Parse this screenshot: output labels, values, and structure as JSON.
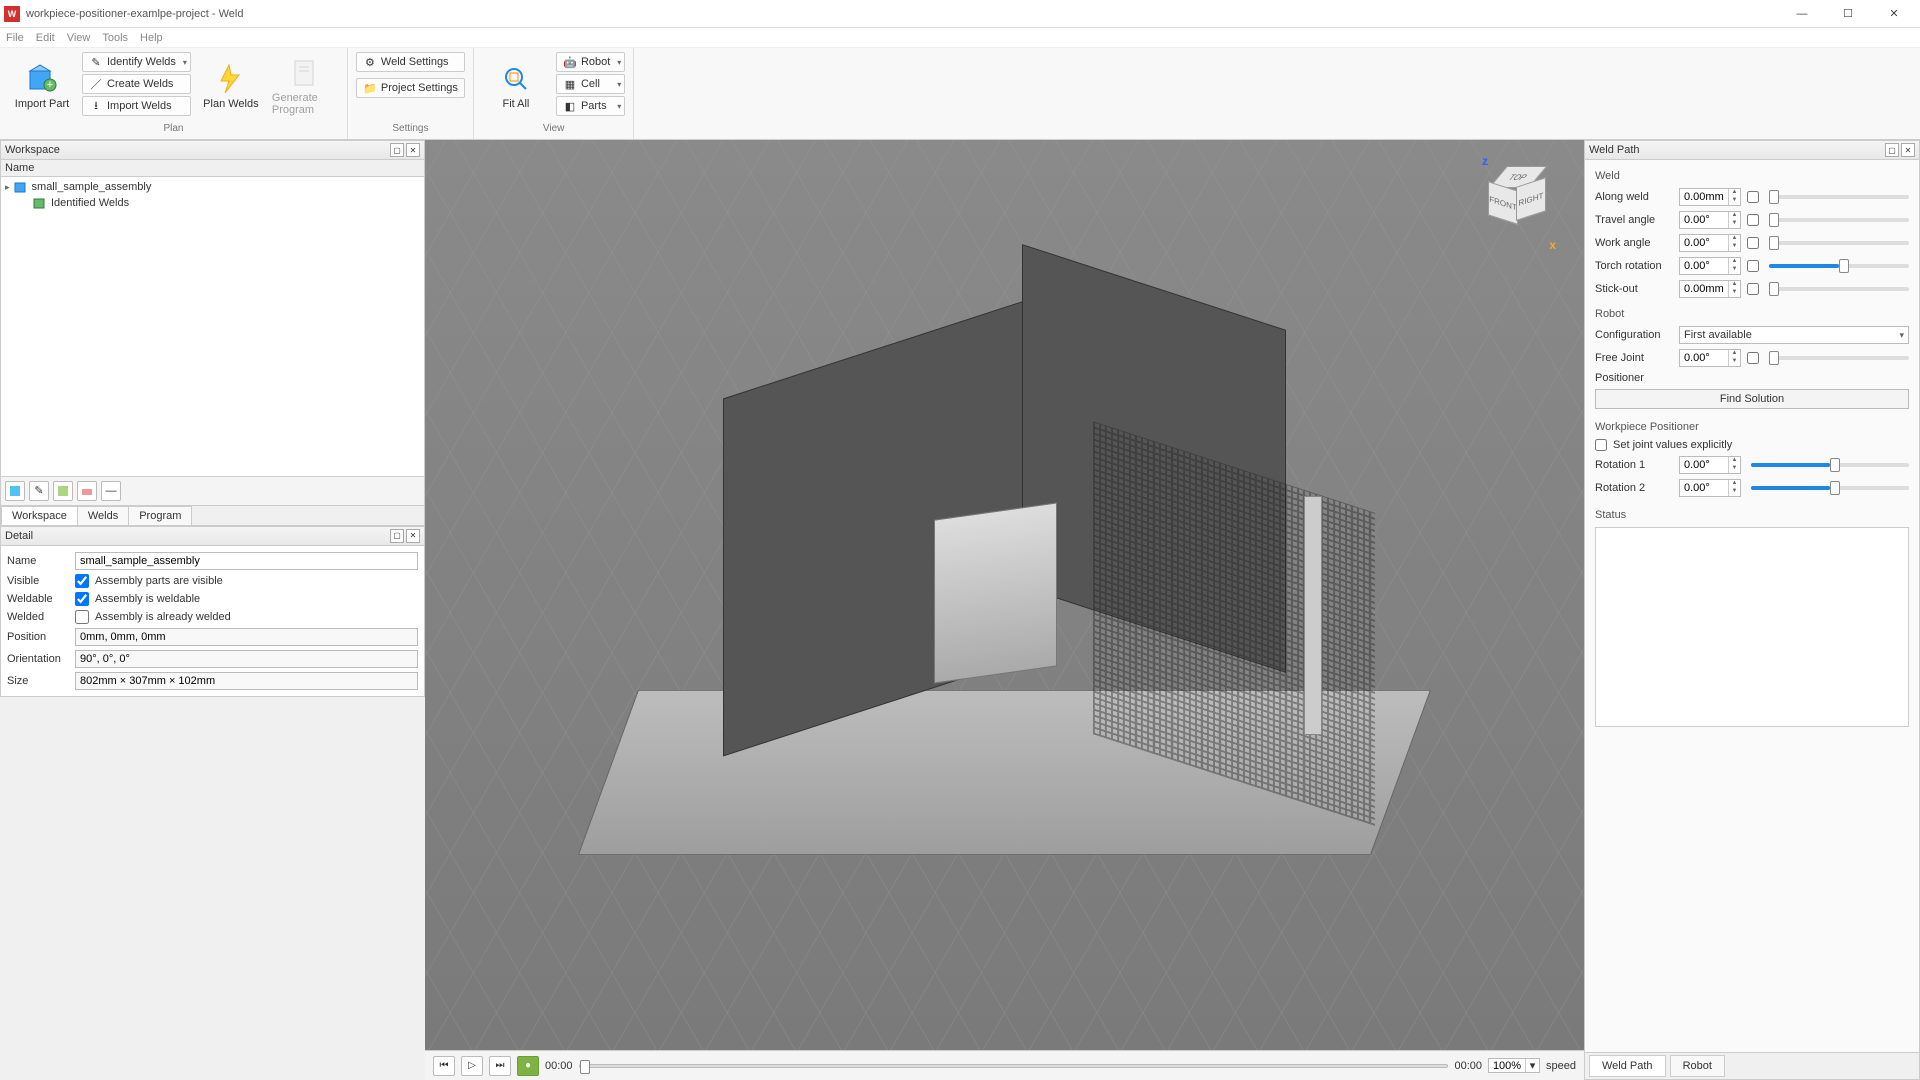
{
  "window": {
    "title": "workpiece-positioner-examlpe-project - Weld",
    "menus": [
      "File",
      "Edit",
      "View",
      "Tools",
      "Help"
    ]
  },
  "ribbon": {
    "import_part": "Import Part",
    "identify_welds": "Identify Welds",
    "create_welds": "Create Welds",
    "import_welds": "Import Welds",
    "plan_welds": "Plan Welds",
    "generate_program": "Generate Program",
    "plan_group": "Plan",
    "weld_settings": "Weld Settings",
    "project_settings": "Project Settings",
    "settings_group": "Settings",
    "fit_all": "Fit All",
    "robot": "Robot",
    "cell": "Cell",
    "parts": "Parts",
    "view_group": "View"
  },
  "workspace": {
    "title": "Workspace",
    "col_name": "Name",
    "items": [
      "small_sample_assembly",
      "Identified Welds"
    ],
    "tabs": [
      "Workspace",
      "Welds",
      "Program"
    ]
  },
  "detail": {
    "title": "Detail",
    "name_lbl": "Name",
    "name_val": "small_sample_assembly",
    "visible_lbl": "Visible",
    "visible_txt": "Assembly parts are visible",
    "weldable_lbl": "Weldable",
    "weldable_txt": "Assembly is weldable",
    "welded_lbl": "Welded",
    "welded_txt": "Assembly is already welded",
    "position_lbl": "Position",
    "position_val": "0mm, 0mm, 0mm",
    "orientation_lbl": "Orientation",
    "orientation_val": "90°, 0°, 0°",
    "size_lbl": "Size",
    "size_val": "802mm × 307mm × 102mm"
  },
  "viewcube": {
    "z": "z",
    "x": "x",
    "top": "TOP",
    "front": "FRONT",
    "right": "RIGHT"
  },
  "playbar": {
    "time_start": "00:00",
    "time_end": "00:00",
    "zoom": "100%",
    "speed": "speed"
  },
  "weldpath": {
    "title": "Weld Path",
    "weld_section": "Weld",
    "along_weld_lbl": "Along weld",
    "along_weld_val": "0.00mm",
    "travel_angle_lbl": "Travel angle",
    "travel_angle_val": "0.00°",
    "work_angle_lbl": "Work angle",
    "work_angle_val": "0.00°",
    "torch_rot_lbl": "Torch rotation",
    "torch_rot_val": "0.00°",
    "stick_out_lbl": "Stick-out",
    "stick_out_val": "0.00mm",
    "robot_section": "Robot",
    "config_lbl": "Configuration",
    "config_val": "First available",
    "free_joint_lbl": "Free Joint",
    "free_joint_val": "0.00°",
    "positioner_lbl": "Positioner",
    "find_solution": "Find Solution",
    "wp_section": "Workpiece Positioner",
    "set_explicit": "Set joint values explicitly",
    "rot1_lbl": "Rotation 1",
    "rot1_val": "0.00°",
    "rot2_lbl": "Rotation 2",
    "rot2_val": "0.00°",
    "status_section": "Status",
    "tabs": [
      "Weld Path",
      "Robot"
    ]
  }
}
